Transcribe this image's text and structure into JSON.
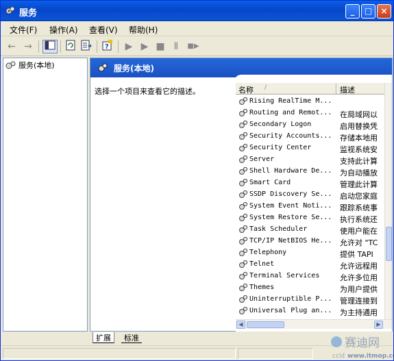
{
  "window": {
    "title": "服务",
    "minimize": "_",
    "maximize": "□",
    "close": "×"
  },
  "menu": [
    "文件(F)",
    "操作(A)",
    "查看(V)",
    "帮助(H)"
  ],
  "toolbar": {
    "back": "←",
    "forward": "→",
    "play": "▶",
    "stop": "■",
    "pause": "Ⅱ",
    "restart": "■▶"
  },
  "tree": {
    "root": "服务(本地)"
  },
  "panel": {
    "title": "服务(本地)",
    "description": "选择一个项目来查看它的描述。"
  },
  "columns": {
    "name": "名称",
    "sort": "/",
    "desc": "描述"
  },
  "services": [
    {
      "name": "Rising RealTime M...",
      "desc": ""
    },
    {
      "name": "Routing and Remot...",
      "desc": "在局域网以"
    },
    {
      "name": "Secondary Logon",
      "desc": "启用替换凭"
    },
    {
      "name": "Security Accounts...",
      "desc": "存储本地用"
    },
    {
      "name": "Security Center",
      "desc": "监视系统安"
    },
    {
      "name": "Server",
      "desc": "支持此计算"
    },
    {
      "name": "Shell Hardware De...",
      "desc": "为自动播放"
    },
    {
      "name": "Smart Card",
      "desc": "管理此计算"
    },
    {
      "name": "SSDP Discovery Se...",
      "desc": "启动您家庭"
    },
    {
      "name": "System Event Noti...",
      "desc": "跟踪系统事"
    },
    {
      "name": "System Restore Se...",
      "desc": "执行系统还"
    },
    {
      "name": "Task Scheduler",
      "desc": "使用户能在"
    },
    {
      "name": "TCP/IP NetBIOS He...",
      "desc": "允许对 \"TC"
    },
    {
      "name": "Telephony",
      "desc": "提供 TAPI"
    },
    {
      "name": "Telnet",
      "desc": "允许远程用"
    },
    {
      "name": "Terminal Services",
      "desc": "允许多位用"
    },
    {
      "name": "Themes",
      "desc": "为用户提供"
    },
    {
      "name": "Uninterruptible P...",
      "desc": "管理连接到"
    },
    {
      "name": "Universal Plug an...",
      "desc": "为主持通用"
    }
  ],
  "tabs": [
    "扩展",
    "标准"
  ],
  "watermark": {
    "brand": "赛迪网",
    "url": "www.itmop.com",
    "cn": "ccid"
  },
  "colors": {
    "titlebar": "#0a5fe8",
    "pane_header": "#1a50c4",
    "chrome": "#ece9d8"
  }
}
